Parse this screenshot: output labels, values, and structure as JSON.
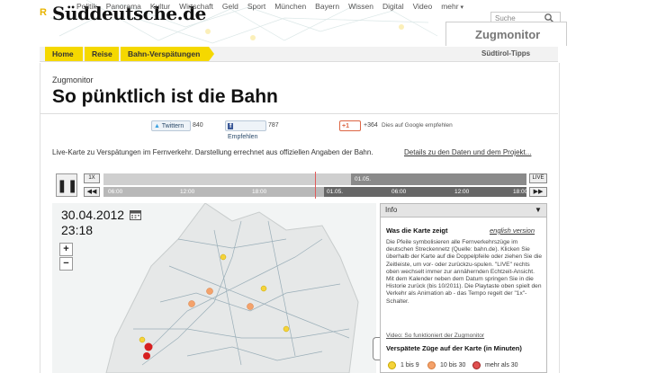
{
  "header": {
    "logo_prefix": "R",
    "logo": "Süddeutsche.de",
    "nav": [
      "Politik",
      "Panorama",
      "Kultur",
      "Wirtschaft",
      "Geld",
      "Sport",
      "München",
      "Bayern",
      "Wissen",
      "Digital",
      "Video"
    ],
    "nav_more": "mehr",
    "search_placeholder": "Suche",
    "section_title": "Zugmonitor"
  },
  "breadcrumb": {
    "items": [
      "Home",
      "Reise",
      "Bahn-Verspätungen"
    ],
    "right_link": "Südtirol-Tipps"
  },
  "article": {
    "kicker": "Zugmonitor",
    "headline": "So pünktlich ist die Bahn",
    "intro": "Live-Karte zu Verspätungen im Fernverkehr. Darstellung errechnet aus offiziellen Angaben der Bahn.",
    "intro_link": "Details zu den Daten und dem Projekt..."
  },
  "social": {
    "twitter_label": "Twittern",
    "twitter_count": "840",
    "facebook_label": "Empfehlen",
    "facebook_count": "787",
    "gplus_label": "+1",
    "gplus_count": "+364",
    "gplus_text": "Dies auf Google empfehlen"
  },
  "timeline": {
    "play_symbol": "❚❚",
    "speed_label": "1X",
    "rewind_symbol": "◀◀",
    "live_label": "LIVE",
    "forward_symbol": "▶▶",
    "ticks_bottom": [
      "06:00",
      "12:00",
      "18:00",
      "01.05.",
      "06:00",
      "12:00",
      "18:00"
    ],
    "tick_top": "01.05."
  },
  "map": {
    "date": "30.04.2012",
    "time": "23:18",
    "zoom_in": "+",
    "zoom_out": "−"
  },
  "info": {
    "title": "Info",
    "heading": "Was die Karte zeigt",
    "english": "english version",
    "body": "Die Pfeile symbolisieren alle Fernverkehrszüge im deutschen Streckennetz (Quelle: bahn.de). Klicken Sie überhalb der Karte auf die Doppelpfeile oder ziehen Sie die Zeitleiste, um vor- oder zurückzu-spulen. \"LIVE\" rechts oben wechselt immer zur annähernden Echtzeit-Ansicht. Mit dem Kalender neben dem Datum springen Sie in die Historie zurück (bis 10/2011). Die Playtaste oben spielt den Verkehr als Animation ab - das Tempo regelt der \"1x\"-Schalter.",
    "video_link": "Video: So funktioniert der Zugmonitor",
    "delay_heading": "Verspätete Züge auf der Karte (in Minuten)",
    "legend": [
      {
        "label": "1 bis 9",
        "color": "#f5d33a"
      },
      {
        "label": "10 bis 30",
        "color": "#f4a26b"
      },
      {
        "label": "mehr als 30",
        "color": "#e05050"
      }
    ]
  },
  "colors": {
    "accent_yellow": "#f5d800",
    "delay_red": "#d62020"
  }
}
